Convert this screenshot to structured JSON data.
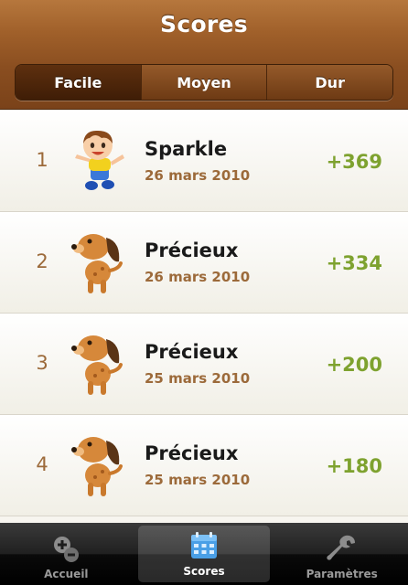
{
  "header": {
    "title": "Scores"
  },
  "segments": [
    {
      "label": "Facile",
      "active": true
    },
    {
      "label": "Moyen",
      "active": false
    },
    {
      "label": "Dur",
      "active": false
    }
  ],
  "scores": [
    {
      "rank": "1",
      "avatar": "boy-icon",
      "name": "Sparkle",
      "date": "26 mars 2010",
      "score": "+369"
    },
    {
      "rank": "2",
      "avatar": "dog-icon",
      "name": "Précieux",
      "date": "26 mars 2010",
      "score": "+334"
    },
    {
      "rank": "3",
      "avatar": "dog-icon",
      "name": "Précieux",
      "date": "25 mars 2010",
      "score": "+200"
    },
    {
      "rank": "4",
      "avatar": "dog-icon",
      "name": "Précieux",
      "date": "25 mars 2010",
      "score": "+180"
    }
  ],
  "tabbar": [
    {
      "label": "Accueil",
      "icon": "add-icon",
      "active": false
    },
    {
      "label": "Scores",
      "icon": "calendar-icon",
      "active": true
    },
    {
      "label": "Paramètres",
      "icon": "wrench-icon",
      "active": false
    }
  ],
  "colors": {
    "header": "#8a4e20",
    "rank": "#9c6a3a",
    "score": "#7ea22f"
  }
}
